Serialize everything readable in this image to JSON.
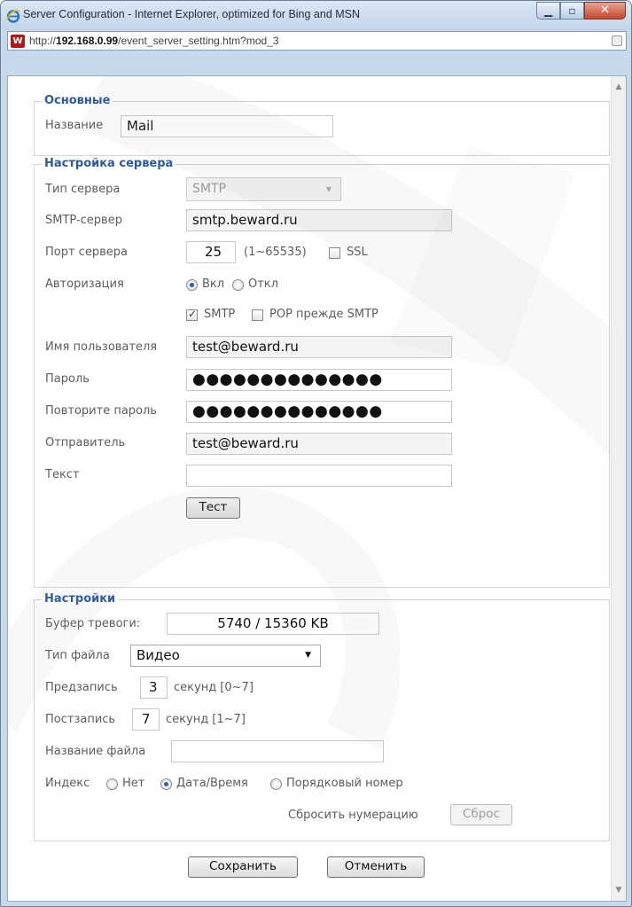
{
  "window": {
    "title": "Server Configuration - Internet Explorer, optimized for Bing and MSN"
  },
  "address": {
    "prefix": "http://",
    "host": "192.168.0.99",
    "path": "/event_server_setting.htm?mod_3"
  },
  "basic": {
    "legend": "Основные",
    "name_label": "Название",
    "name_value": "Mail"
  },
  "server": {
    "legend": "Настройка сервера",
    "type_label": "Тип сервера",
    "type_value": "SMTP",
    "smtp_label": "SMTP-сервер",
    "smtp_value": "smtp.beward.ru",
    "port_label": "Порт сервера",
    "port_value": "25",
    "port_range": "(1~65535)",
    "ssl_label": "SSL",
    "ssl_checked": false,
    "auth_label": "Авторизация",
    "auth_on_label": "Вкл",
    "auth_off_label": "Откл",
    "auth_selected": "on",
    "smtp_check_label": "SMTP",
    "smtp_check_checked": true,
    "pop_check_label": "POP прежде SMTP",
    "pop_check_checked": false,
    "user_label": "Имя пользователя",
    "user_value": "test@beward.ru",
    "password_label": "Пароль",
    "password_value": "●●●●●●●●●●●●●●",
    "repeat_label": "Повторите пароль",
    "repeat_value": "●●●●●●●●●●●●●●",
    "sender_label": "Отправитель",
    "sender_value": "test@beward.ru",
    "text_label": "Текст",
    "text_value": "",
    "test_button": "Тест"
  },
  "settings": {
    "legend": "Настройки",
    "buffer_label": "Буфер тревоги:",
    "buffer_value": "5740 / 15360 KB",
    "filetype_label": "Тип файла",
    "filetype_value": "Видео",
    "prerecord_label": "Предзапись",
    "prerecord_value": "3",
    "prerecord_unit": "секунд [0~7]",
    "postrecord_label": "Постзапись",
    "postrecord_value": "7",
    "postrecord_unit": "секунд [1~7]",
    "filename_label": "Название файла",
    "filename_value": "",
    "index_label": "Индекс",
    "index_none": "Нет",
    "index_datetime": "Дата/Время",
    "index_sequence": "Порядковый номер",
    "index_selected": "datetime",
    "reset_label": "Сбросить нумерацию",
    "reset_button": "Сброс"
  },
  "footer": {
    "save_button": "Сохранить",
    "cancel_button": "Отменить"
  },
  "colors": {
    "legend": "#2c5aa0",
    "label": "#5c5c5c",
    "titlebar": "#c3d5ea"
  },
  "icons": [
    "ie-icon",
    "site-icon",
    "minimize-icon",
    "maximize-icon",
    "close-icon",
    "compat-view-icon",
    "scroll-up-icon",
    "scroll-down-icon"
  ]
}
